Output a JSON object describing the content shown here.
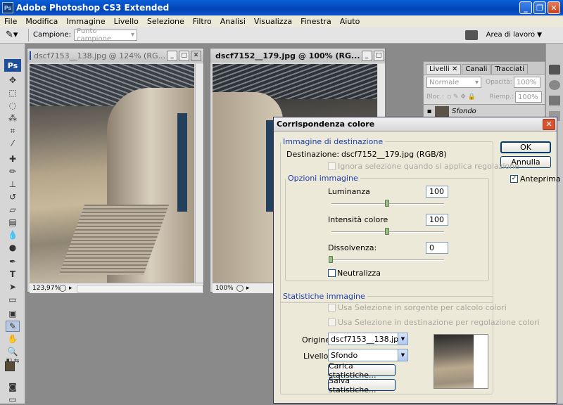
{
  "app": {
    "title": "Adobe Photoshop CS3 Extended",
    "logo": "Ps"
  },
  "menu": [
    "File",
    "Modifica",
    "Immagine",
    "Livello",
    "Selezione",
    "Filtro",
    "Analisi",
    "Visualizza",
    "Finestra",
    "Aiuto"
  ],
  "options": {
    "campione_label": "Campione:",
    "campione_value": "Punto campione",
    "workspace": "Area di lavoro"
  },
  "doc1": {
    "title": "dscf7153__138.jpg @ 124% (RG...",
    "zoom": "123,97%"
  },
  "doc2": {
    "title": "dscf7152__179.jpg @ 100% (RG...",
    "zoom": "100%"
  },
  "layers": {
    "tabs": [
      "Livelli",
      "Canali",
      "Tracciati"
    ],
    "blend": "Normale",
    "opacity_label": "Opacità:",
    "opacity": "100%",
    "lock_label": "Bloc.:",
    "fill_label": "Riemp.:",
    "fill": "100%",
    "layer_name": "Sfondo"
  },
  "dialog": {
    "title": "Corrispondenza colore",
    "ok": "OK",
    "cancel": "Annulla",
    "preview": "Anteprima",
    "dest_group": "Immagine di destinazione",
    "dest_label": "Destinazione:",
    "dest_value": "dscf7152__179.jpg (RGB/8)",
    "ignore_sel": "Ignora selezione quando si applica regolazione",
    "options_group": "Opzioni immagine",
    "lum_label": "Luminanza",
    "lum_value": "100",
    "intensity_label": "Intensità colore",
    "intensity_value": "100",
    "fade_label": "Dissolvenza:",
    "fade_value": "0",
    "neutralize": "Neutralizza",
    "stats_group": "Statistiche immagine",
    "use_src": "Usa Selezione in sorgente per calcolo colori",
    "use_dst": "Usa Selezione in destinazione per regolazione colori",
    "source_label": "Origine:",
    "source_value": "dscf7153__138.jpg",
    "layer_label": "Livello:",
    "layer_value": "Sfondo",
    "load_stats": "Carica statistiche...",
    "save_stats": "Salva statistiche..."
  }
}
